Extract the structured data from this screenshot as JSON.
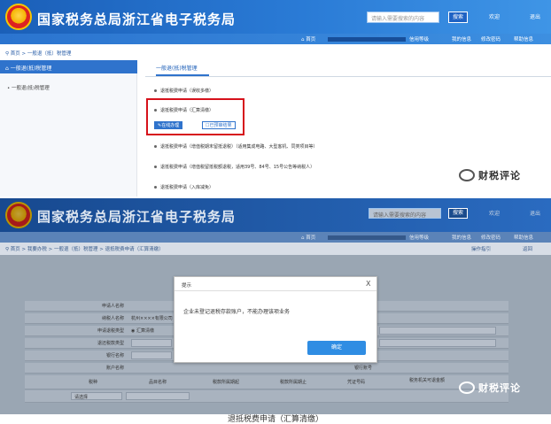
{
  "top": {
    "agency_title": "国家税务总局浙江省电子税务局",
    "search_placeholder": "请输入需要搜索的内容",
    "search_button": "搜索",
    "welcome": "欢迎",
    "logout": "退出",
    "nav_home": "首页",
    "nav_info_center": "信用等级",
    "nav_my_info": "我的信息",
    "nav_change_password": "修改密码",
    "nav_help": "帮助信息",
    "breadcrumb": [
      "首页",
      "一般退（抵）税管理"
    ],
    "sidebar_active": "一般退(抵)税管理",
    "sidebar_sub": "一般退(抵)税管理",
    "panel_title": "一般退(抵)税管理",
    "items": [
      "退抵税费申请（误收多缴）",
      "退抵税费申请（汇算清缴）",
      "退抵税费申请（增值税期末留抵退税）（适用集成电路、大型客机、同类项目等）",
      "退抵税费申请（增值税留抵税额退税，适用39号、84号、15号公告等纳税人）",
      "退抵税费申请（入库减免）"
    ],
    "online_btn": "在线办理",
    "handled_btn": "已预审结果",
    "watermark": "财税评论"
  },
  "bottom": {
    "agency_title": "国家税务总局浙江省电子税务局",
    "search_placeholder": "请输入需要搜索的内容",
    "search_button": "搜索",
    "welcome": "欢迎",
    "logout": "退出",
    "nav_home": "首页",
    "nav_info_center": "信用等级",
    "nav_my_info": "我的信息",
    "nav_change_password": "修改密码",
    "nav_help": "帮助信息",
    "breadcrumb": "首页 > 我要办税 > 一般退（抵）税管理 > 退抵税费申请（汇算清缴）",
    "ops_guide": "操作指引",
    "return": "返回",
    "labels": {
      "applicant_name": "申请人名称",
      "taxpayer_name": "纳税人名称",
      "apply_type": "申请退税类型",
      "refund_reason": "退还税款类型",
      "bank": "银行名称",
      "account_name": "账户名称",
      "account_no": "银行账号",
      "tax_type": "税种",
      "item": "品目名称",
      "amount_paid": "税款所属期起",
      "amount_end": "税款所属期止",
      "voucher_no": "凭证号码",
      "refund_amount": "税务机关可退金额"
    },
    "taxpayer_value": "杭州××××有限公司",
    "apply_type_value": "汇算清缴",
    "select_hint": "请选择",
    "dialog": {
      "title": "提示",
      "message": "企业未登记退税存款账户，不能办理该项业务",
      "ok": "确定",
      "close": "X"
    },
    "watermark": "财税评论"
  },
  "caption": "退抵税费申请（汇算清缴）"
}
